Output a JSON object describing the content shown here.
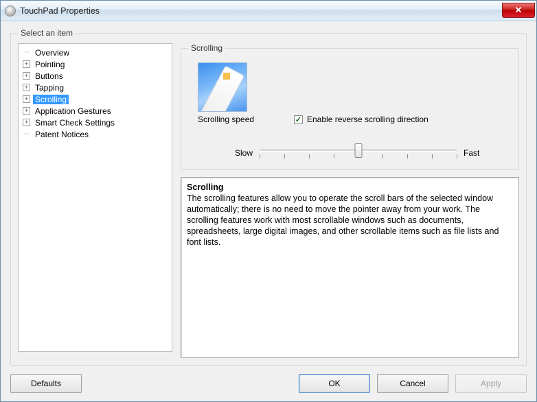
{
  "window": {
    "title": "TouchPad Properties"
  },
  "outer_group": {
    "legend": "Select an item"
  },
  "tree": {
    "items": [
      {
        "label": "Overview",
        "expandable": false,
        "selected": false
      },
      {
        "label": "Pointing",
        "expandable": true,
        "selected": false
      },
      {
        "label": "Buttons",
        "expandable": true,
        "selected": false
      },
      {
        "label": "Tapping",
        "expandable": true,
        "selected": false
      },
      {
        "label": "Scrolling",
        "expandable": true,
        "selected": true
      },
      {
        "label": "Application Gestures",
        "expandable": true,
        "selected": false
      },
      {
        "label": "Smart Check Settings",
        "expandable": true,
        "selected": false
      },
      {
        "label": "Patent Notices",
        "expandable": false,
        "selected": false
      }
    ]
  },
  "scrolling": {
    "group_legend": "Scrolling",
    "speed_label": "Scrolling speed",
    "checkbox": {
      "label": "Enable reverse scrolling direction",
      "checked": true
    },
    "slider": {
      "min_label": "Slow",
      "max_label": "Fast",
      "ticks": 9,
      "value_index": 4
    }
  },
  "description": {
    "heading": "Scrolling",
    "body": "The scrolling features allow you to operate the scroll bars of the selected window automatically; there is no need to move the pointer away from your work. The scrolling features work with most scrollable windows such as documents, spreadsheets, large digital images, and other scrollable items such as file lists and font lists."
  },
  "buttons": {
    "defaults": "Defaults",
    "ok": "OK",
    "cancel": "Cancel",
    "apply": "Apply"
  }
}
